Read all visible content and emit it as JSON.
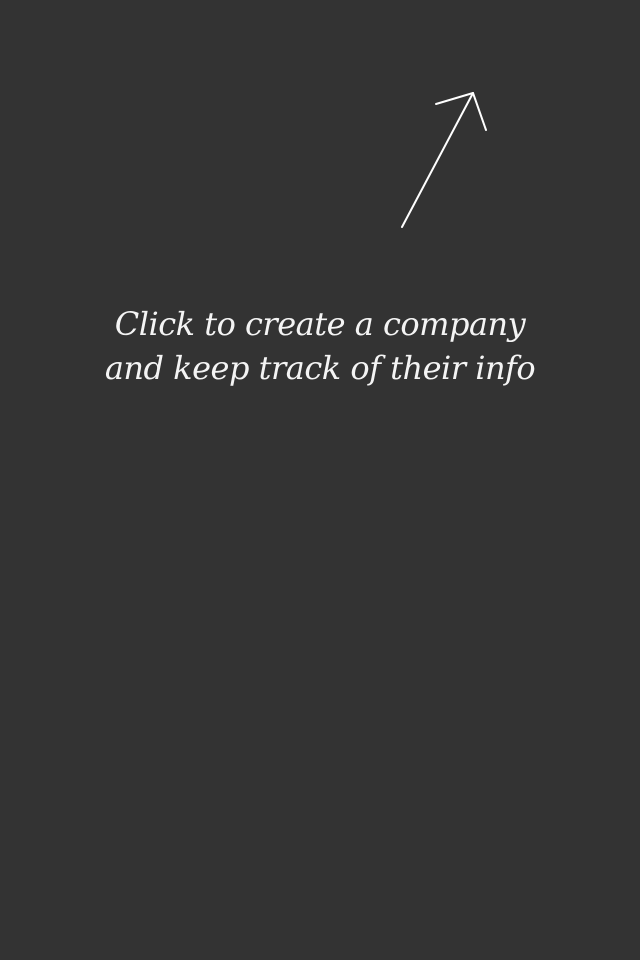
{
  "empty_state": {
    "hint_line_1": "Click to create a company",
    "hint_line_2": "and keep track of their info",
    "pointer_icon": "arrow-up-right-icon"
  },
  "colors": {
    "background": "#333333",
    "text": "#f4f4f4",
    "arrow": "#ffffff"
  }
}
